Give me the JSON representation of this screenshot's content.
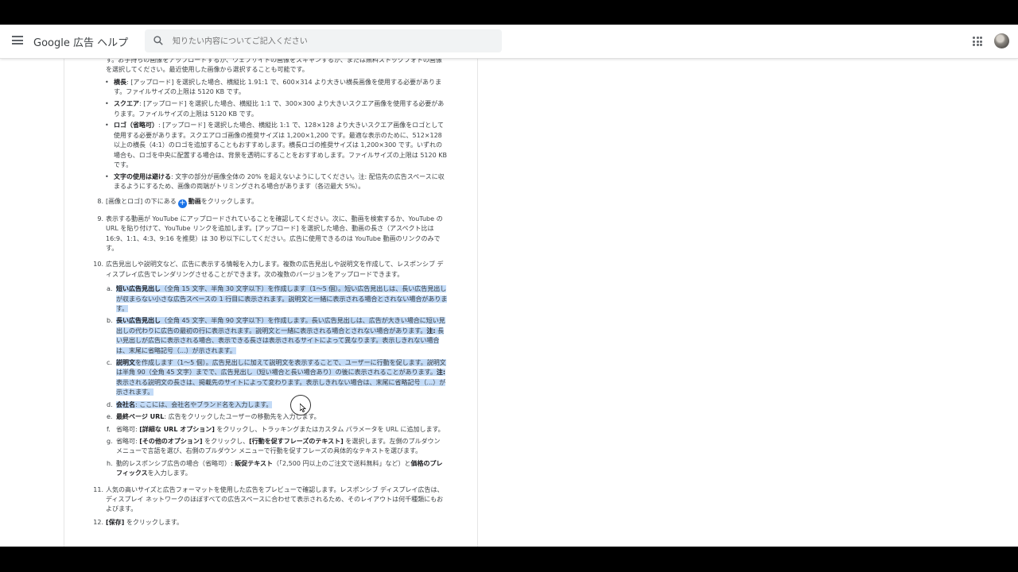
{
  "header": {
    "brand": "Google 広告 ヘルプ",
    "search_placeholder": "知りたい内容についてご記入ください"
  },
  "article": {
    "intro": "す。お手持ちの画像をアップロードするか、ウェブサイトの画像をスキャンするか、または無料ストックフォトの画像を選択してください。最近使用した画像から選択することも可能です。",
    "bullets": [
      {
        "label": "横長",
        "text": ": [アップロード] を選択した場合、横縦比 1.91:1 で、600×314 より大きい横長画像を使用する必要があります。ファイルサイズの上限は 5120 KB です。"
      },
      {
        "label": "スクエア",
        "text": ": [アップロード] を選択した場合、横縦比 1:1 で、300×300 より大きいスクエア画像を使用する必要があります。ファイルサイズの上限は 5120 KB です。"
      },
      {
        "label": "ロゴ（省略可）",
        "text": ": [アップロード] を選択した場合、横縦比 1:1 で、128×128 より大きいスクエア画像をロゴとして使用する必要があります。スクエアロゴ画像の推奨サイズは 1,200×1,200 です。最適な表示のために、512×128 以上の横長（4:1）のロゴを追加することもおすすめします。横長ロゴの推奨サイズは 1,200×300 です。いずれの場合も、ロゴを中央に配置する場合は、背景を透明にすることをおすすめします。ファイルサイズの上限は 5120 KB です。"
      },
      {
        "label": "文字の使用は避ける",
        "text": ": 文字の部分が画像全体の 20% を超えないようにしてください。注: 配信先の広告スペースに収まるようにするため、画像の両端がトリミングされる場合があります（各辺最大 5%）。"
      }
    ],
    "step8": {
      "num": "8.",
      "pre": "[画像とロゴ] の下にある",
      "icon": "+",
      "bold": "動画",
      "post": "をクリックします。"
    },
    "step9": {
      "num": "9.",
      "text": "表示する動画が YouTube にアップロードされていることを確認してください。次に、動画を検索するか、YouTube の URL を貼り付けて、YouTube リンクを追加します。[アップロード] を選択した場合、動画の長さ（アスペクト比は 16:9、1:1、4:3、9:16 を推奨）は 30 秒以下にしてください。広告に使用できるのは YouTube 動画のリンクのみです。"
    },
    "step10": {
      "num": "10.",
      "text": "広告見出しや説明文など、広告に表示する情報を入力します。複数の広告見出しや説明文を作成して、レスポンシブ ディスプレイ広告でレンダリングさせることができます。次の複数のバージョンをアップロードできます。"
    },
    "sub": {
      "a": {
        "letter": "a.",
        "bold": "短い広告見出し",
        "text": "（全角 15 文字、半角 30 文字以下）を作成します（1〜5 個）。短い広告見出しは、長い広告見出しが収まらない小さな広告スペースの 1 行目に表示されます。説明文と一緒に表示される場合とされない場合があります。"
      },
      "b": {
        "letter": "b.",
        "bold": "長い広告見出し",
        "text1": "（全角 45 文字、半角 90 文字以下）を作成します。長い広告見出しは、広告が大きい場合に短い見出しの代わりに広告の最初の行に表示されます。説明文と一緒に表示される場合とされない場合があります。",
        "note": "注:",
        "text2": " 長い見出しが広告に表示される場合、表示できる長さは表示されるサイトによって異なります。表示しきれない場合は、末尾に省略記号（...）が示されます。"
      },
      "c": {
        "letter": "c.",
        "bold": "説明文",
        "text1": "を作成します（1〜5 個）。広告見出しに加えて説明文を表示することで、ユーザーに行動を促します。説明文は半角 90（全角 45 文字）までで、広告見出し（短い場合と長い場合あり）の後に表示されることがあります。",
        "note": "注:",
        "text2": " 表示される説明文の長さは、掲載先のサイトによって変わります。表示しきれない場合は、末尾に省略記号（...）が示されます。"
      },
      "d": {
        "letter": "d.",
        "bold": "会社名",
        "text": ": ここには、会社名やブランド名を入力します。"
      },
      "e": {
        "letter": "e.",
        "bold": "最終ページ URL",
        "text": ": 広告をクリックしたユーザーの移動先を入力します。"
      },
      "f": {
        "letter": "f.",
        "pre": "省略可: ",
        "bold": "[詳細な URL オプション]",
        "text": " をクリックし、トラッキングまたはカスタム パラメータを URL に追加します。"
      },
      "g": {
        "letter": "g.",
        "pre": "省略可: ",
        "bold1": "[その他のオプション]",
        "mid": " をクリックし、",
        "bold2": "[行動を促すフレーズのテキスト]",
        "text": " を選択します。左側のプルダウン メニューで言語を選び、右側のプルダウン メニューで行動を促すフレーズの具体的なテキストを選びます。"
      },
      "h": {
        "letter": "h.",
        "pre": "動的レスポンシブ広告の場合（省略可）: ",
        "bold1": "販促テキスト",
        "mid": "（「2,500 円以上のご注文で送料無料」など）と",
        "bold2": "価格のプレフィックス",
        "text": "を入力します。"
      }
    },
    "step11": {
      "num": "11.",
      "text": "人気の高いサイズと広告フォーマットを使用した広告をプレビューで確認します。レスポンシブ ディスプレイ広告は、ディスプレイ ネットワークのほぼすべての広告スペースに合わせて表示されるため、そのレイアウトは何千種類にもおよびます。"
    },
    "step12": {
      "num": "12.",
      "bold": "[保存]",
      "text": " をクリックします。"
    }
  }
}
